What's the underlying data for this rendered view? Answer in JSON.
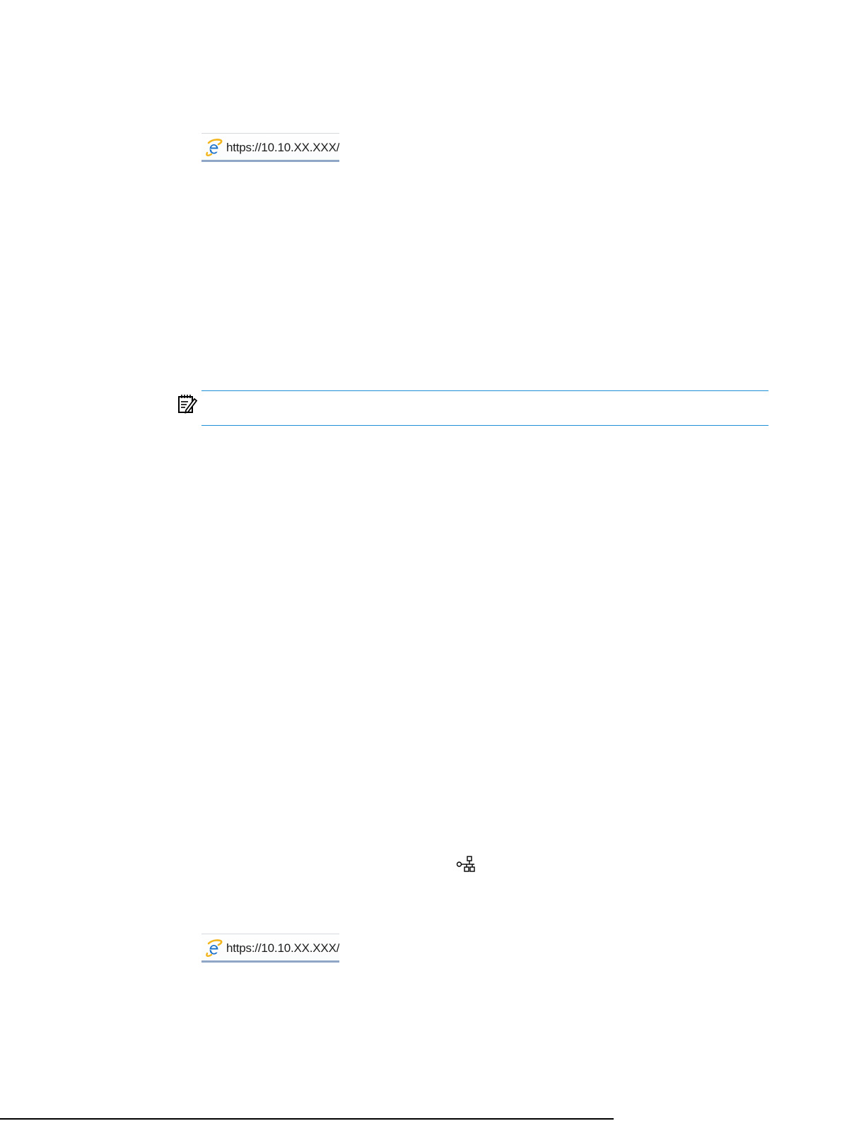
{
  "address_bars": [
    {
      "url": "https://10.10.XX.XXX/",
      "icon": "internet-explorer-icon"
    },
    {
      "url": "https://10.10.XX.XXX/",
      "icon": "internet-explorer-icon"
    }
  ],
  "note": {
    "icon": "note-icon",
    "rule_color": "#1f90d6"
  },
  "network": {
    "icon": "network-icon"
  },
  "colors": {
    "accent": "#1f90d6",
    "ie_blue": "#1e73c9",
    "ie_gold": "#f2b51c"
  }
}
